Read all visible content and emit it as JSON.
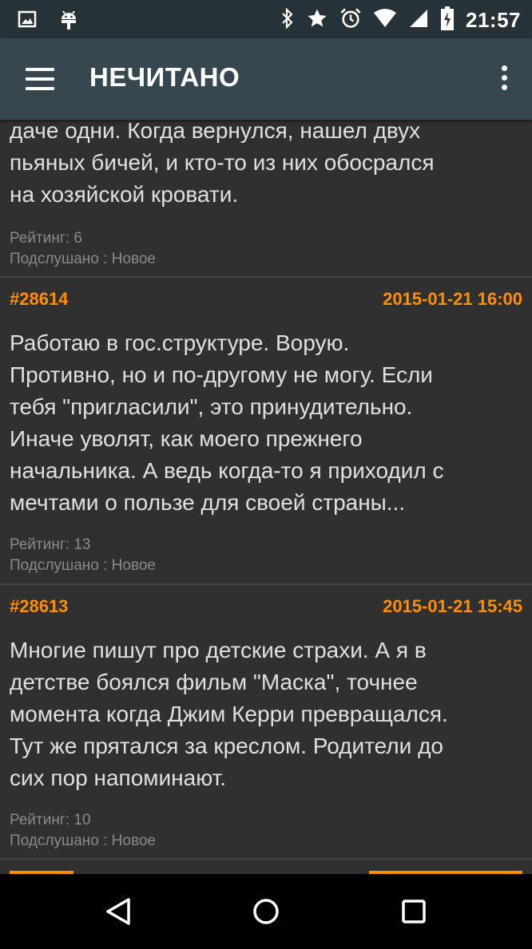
{
  "status_bar": {
    "time": "21:57",
    "left_icons": [
      "image-notification-icon",
      "android-debug-icon"
    ],
    "right_icons": [
      "bluetooth-icon",
      "star-icon",
      "alarm-icon",
      "wifi-icon",
      "signal-icon",
      "battery-charging-icon"
    ]
  },
  "toolbar": {
    "title": "НЕЧИТАНО",
    "menu_icon": "hamburger-menu-icon",
    "overflow_icon": "more-vert-icon"
  },
  "posts": [
    {
      "text": "даче одни. Когда вернулся, нашел двух\nпьяных бичей, и кто-то из них обосрался\nна хозяйской кровати.",
      "rating": "Рейтинг: 6",
      "category": "Подслушано : Новое"
    },
    {
      "id": "#28614",
      "date": "2015-01-21 16:00",
      "text": "Работаю в гос.структуре. Ворую.\nПротивно, но и по-другому не могу. Если\nтебя \"пригласили\", это принудительно.\nИначе уволят, как моего прежнего\nначальника. А ведь когда-то я приходил с\nмечтами о пользе для своей страны...",
      "rating": "Рейтинг: 13",
      "category": "Подслушано : Новое"
    },
    {
      "id": "#28613",
      "date": "2015-01-21 15:45",
      "text": "Многие пишут про детские страхи. А я в\nдетстве боялся фильм \"Маска\", точнее\nмомента когда Джим Керри превращался.\nТут же прятался за креслом. Родители до\nсих пор напоминают.",
      "rating": "Рейтинг: 10",
      "category": "Подслушано : Новое"
    }
  ],
  "nav_bar": {
    "icons": [
      "back-icon",
      "home-icon",
      "recents-icon"
    ]
  },
  "colors": {
    "status_bar": "#263238",
    "toolbar": "#37474f",
    "background": "#303030",
    "accent": "#ff8f00",
    "text": "#e0e0e0",
    "meta_text": "#8a8a8a"
  }
}
